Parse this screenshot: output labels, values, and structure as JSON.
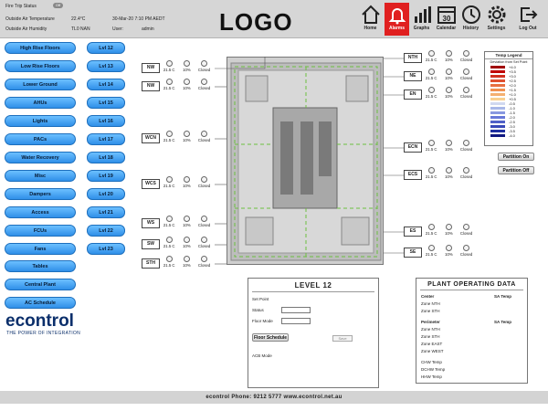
{
  "status": {
    "fire_trip_label": "Fire Trip Status",
    "fire_trip_value": "Off",
    "oat_label": "Outside Air Temperature",
    "oat_value": "22.4°C",
    "oah_label": "Outside Air Humidity",
    "oah_value": "TL0 NAN",
    "datetime": "30-Mar-20 7:10 PM AEDT",
    "user_label": "User:",
    "user_value": "admin"
  },
  "logo_text": "LOGO",
  "toolbar": [
    {
      "label": "Home",
      "icon": "home-icon"
    },
    {
      "label": "Alarms",
      "icon": "bell-icon"
    },
    {
      "label": "Graphs",
      "icon": "bar-graph-icon"
    },
    {
      "label": "Calendar",
      "icon": "calendar-icon",
      "day": "30"
    },
    {
      "label": "History",
      "icon": "clock-icon"
    },
    {
      "label": "Settings",
      "icon": "gear-icon"
    },
    {
      "label": "Log Out",
      "icon": "logout-icon"
    }
  ],
  "sidebar": [
    "High Rise Floors",
    "Low Rise Floors",
    "Lower Ground",
    "AHUs",
    "Lights",
    "PACs",
    "Water Recovery",
    "Misc",
    "Dampers",
    "Access",
    "FCUs",
    "Fans",
    "Tables",
    "Central Plant",
    "AC Schedule"
  ],
  "levels": [
    "Lvl 12",
    "Lvl 13",
    "Lvl 14",
    "Lvl 15",
    "Lvl 16",
    "Lvl 17",
    "Lvl 18",
    "Lvl 19",
    "Lvl 20",
    "Lvl 21",
    "Lvl 22",
    "Lvl 23"
  ],
  "zones_left": [
    {
      "id": "NW",
      "temp": "21.5 C",
      "pct": "10%",
      "state": "Closed"
    },
    {
      "id": "NW",
      "temp": "21.5 C",
      "pct": "10%",
      "state": "Closed"
    },
    {
      "id": "WCN",
      "temp": "21.5 C",
      "pct": "10%",
      "state": "Closed"
    },
    {
      "id": "WCS",
      "temp": "21.5 C",
      "pct": "10%",
      "state": "Closed"
    },
    {
      "id": "WS",
      "temp": "21.5 C",
      "pct": "10%",
      "state": "Closed"
    },
    {
      "id": "SW",
      "temp": "21.5 C",
      "pct": "10%",
      "state": "Closed"
    },
    {
      "id": "STH",
      "temp": "21.5 C",
      "pct": "10%",
      "state": "Closed"
    }
  ],
  "zones_right": [
    {
      "id": "NTH",
      "temp": "21.5 C",
      "pct": "10%",
      "state": "Closed"
    },
    {
      "id": "NE",
      "temp": "21.5 C",
      "pct": "10%",
      "state": "Closed"
    },
    {
      "id": "EN",
      "temp": "21.5 C",
      "pct": "10%",
      "state": "Closed"
    },
    {
      "id": "ECN",
      "temp": "21.5 C",
      "pct": "10%",
      "state": "Closed"
    },
    {
      "id": "ECS",
      "temp": "21.5 C",
      "pct": "10%",
      "state": "Closed"
    },
    {
      "id": "ES",
      "temp": "21.5 C",
      "pct": "10%",
      "state": "Closed"
    },
    {
      "id": "SE",
      "temp": "21.5 C",
      "pct": "10%",
      "state": "Closed"
    }
  ],
  "legend": {
    "title": "Temp Legend",
    "subtitle": "Deviation from Set Point",
    "rows": [
      {
        "label": "+4.0",
        "color": "#a00000"
      },
      {
        "label": "+3.5",
        "color": "#c00000"
      },
      {
        "label": "+3.0",
        "color": "#d03020"
      },
      {
        "label": "+2.5",
        "color": "#e05030"
      },
      {
        "label": "+2.0",
        "color": "#e87040"
      },
      {
        "label": "+1.5",
        "color": "#f09050"
      },
      {
        "label": "+1.0",
        "color": "#f4b070"
      },
      {
        "label": "+0.5",
        "color": "#f8d090"
      },
      {
        "label": "-0.5",
        "color": "#d0d8f0"
      },
      {
        "label": "-1.0",
        "color": "#a8b8e8"
      },
      {
        "label": "-1.5",
        "color": "#8898e0"
      },
      {
        "label": "-2.0",
        "color": "#6878d8"
      },
      {
        "label": "-2.5",
        "color": "#5060c8"
      },
      {
        "label": "-3.0",
        "color": "#3848b8"
      },
      {
        "label": "-3.5",
        "color": "#2030a0"
      },
      {
        "label": "-4.0",
        "color": "#101880"
      }
    ]
  },
  "partition_on": "Partition On",
  "partition_off": "Partition Off",
  "level_panel": {
    "title": "LEVEL 12",
    "set_point": "Set Point",
    "status": "Status",
    "floor_mode": "Floor Mode",
    "schedule_btn": "Floor Schedule",
    "save": "Save",
    "acb_mode": "ACB Mode"
  },
  "plant": {
    "title": "PLANT OPERATING DATA",
    "center": "Center",
    "sa_temp": "SA Temp",
    "zone_nth": "Zone NTH",
    "zone_sth": "Zone STH",
    "perimeter": "Perimeter",
    "sa_temp2": "SA Temp",
    "zone_nth2": "Zone NTH",
    "zone_sth2": "Zone STH",
    "zone_east": "Zone EAST",
    "zone_west": "Zone WEST",
    "chw": "CHW Temp",
    "dchw": "DCHW Temp",
    "hhw": "HHW Temp"
  },
  "brand": {
    "name": "econtrol",
    "tagline": "THE POWER OF INTEGRATION"
  },
  "footer": "econtrol     Phone: 9212 5777     www.econtrol.net.au"
}
